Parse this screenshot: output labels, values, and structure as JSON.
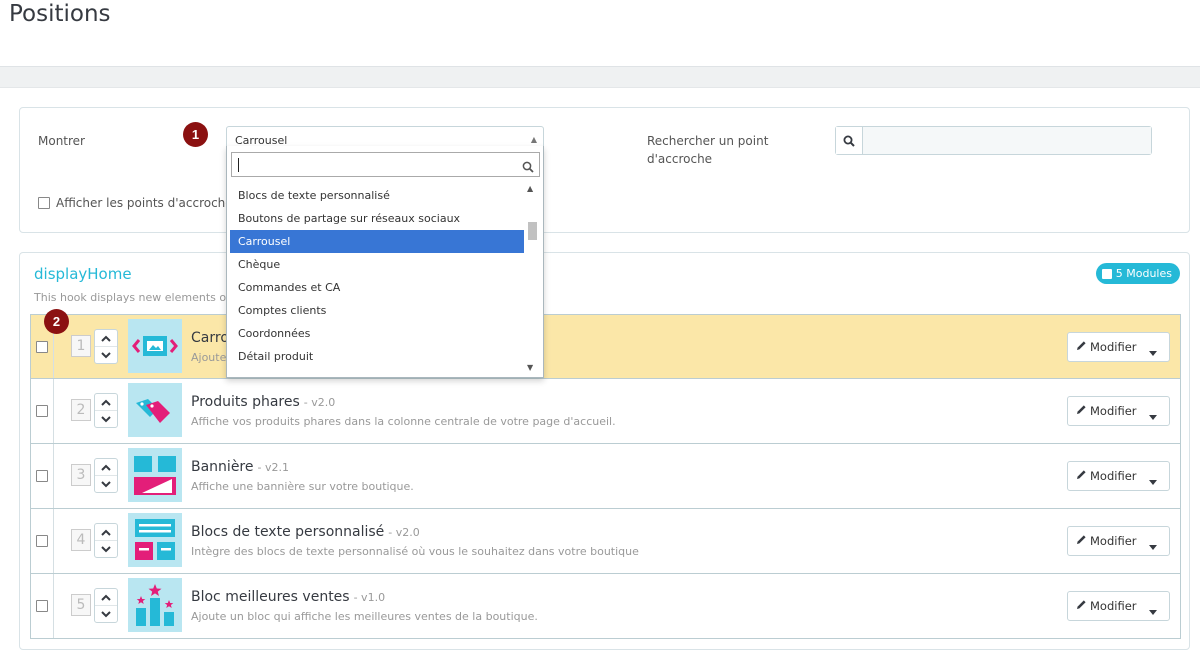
{
  "page": {
    "title": "Positions"
  },
  "filter": {
    "show_label": "Montrer",
    "selected_module": "Carrousel",
    "search_label": "Rechercher un point d'accroche",
    "search_placeholder": "",
    "show_hooks_label": "Afficher les points d'accroche"
  },
  "callouts": {
    "one": "1",
    "two": "2"
  },
  "dropdown": {
    "search_value": "",
    "items": [
      "Blocs de texte personnalisé",
      "Boutons de partage sur réseaux sociaux",
      "Carrousel",
      "Chèque",
      "Commandes et CA",
      "Comptes clients",
      "Coordonnées",
      "Détail produit"
    ],
    "selected_index": 2
  },
  "hook": {
    "name": "displayHome",
    "description": "This hook displays new elements on",
    "modules_count_label": "5 Modules",
    "accent_color": "#25b9d7"
  },
  "modules": [
    {
      "position": "1",
      "name": "Carro",
      "version": "",
      "description": "Ajoute",
      "icon": "carousel-icon",
      "highlighted": true,
      "button_label": "Modifier"
    },
    {
      "position": "2",
      "name": "Produits phares",
      "version": "- v2.0",
      "description": "Affiche vos produits phares dans la colonne centrale de votre page d'accueil.",
      "icon": "featured-products-icon",
      "highlighted": false,
      "button_label": "Modifier"
    },
    {
      "position": "3",
      "name": "Bannière",
      "version": "- v2.1",
      "description": "Affiche une bannière sur votre boutique.",
      "icon": "banner-icon",
      "highlighted": false,
      "button_label": "Modifier"
    },
    {
      "position": "4",
      "name": "Blocs de texte personnalisé",
      "version": "- v2.0",
      "description": "Intègre des blocs de texte personnalisé où vous le souhaitez dans votre boutique",
      "icon": "text-blocks-icon",
      "highlighted": false,
      "button_label": "Modifier"
    },
    {
      "position": "5",
      "name": "Bloc meilleures ventes",
      "version": "- v1.0",
      "description": "Ajoute un bloc qui affiche les meilleures ventes de la boutique.",
      "icon": "best-sellers-icon",
      "highlighted": false,
      "button_label": "Modifier"
    }
  ]
}
